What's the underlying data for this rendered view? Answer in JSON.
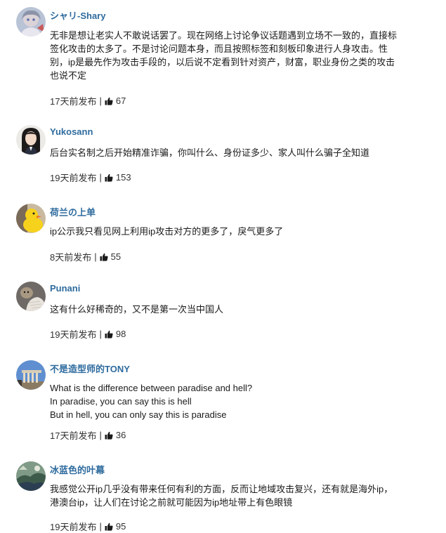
{
  "colors": {
    "username": "#2e6b9e",
    "text": "#1a1a1a",
    "meta": "#333333"
  },
  "comments": [
    {
      "username": "シャリ-Shary",
      "avatar": "avatar-anime-girl-icon",
      "lines": [
        "无非是想让老实人不敢说话罢了。现在网络上讨论争议话题遇到立场不一致的，直接标",
        "签化攻击的太多了。不是讨论问题本身，而且按照标签和刻板印象进行人身攻击。性",
        "别，ip是最先作为攻击手段的，以后说不定看到针对资产，财富，职业身份之类的攻击",
        "也说不定"
      ],
      "time": "17天前发布",
      "sep": "|",
      "likes": "67"
    },
    {
      "username": "Yukosann",
      "avatar": "avatar-girl-portrait-icon",
      "lines": [
        "后台实名制之后开始精准诈骗，你叫什么、身份证多少、家人叫什么骗子全知道"
      ],
      "time": "19天前发布",
      "sep": "|",
      "likes": "153"
    },
    {
      "username": "荷兰の上单",
      "avatar": "avatar-yellow-duck-icon",
      "lines": [
        "ip公示我只看见网上利用ip攻击对方的更多了，戾气更多了"
      ],
      "time": "8天前发布",
      "sep": "|",
      "likes": "55"
    },
    {
      "username": "Punani",
      "avatar": "avatar-dog-icon",
      "lines": [
        "这有什么好稀奇的，又不是第一次当中国人"
      ],
      "time": "19天前发布",
      "sep": "|",
      "likes": "98"
    },
    {
      "username": "不是造型师的TONY",
      "avatar": "avatar-parthenon-icon",
      "lines": [
        "What is the difference between paradise and hell?",
        "In paradise, you can say this is hell",
        "But in hell, you can only say this is paradise"
      ],
      "time": "17天前发布",
      "sep": "|",
      "likes": "36"
    },
    {
      "username": "冰蓝色的叶幕",
      "avatar": "avatar-landscape-icon",
      "lines": [
        "我感觉公开ip几乎没有带来任何有利的方面，反而让地域攻击复兴，还有就是海外ip，",
        "港澳台ip，让人们在讨论之前就可能因为ip地址带上有色眼镜"
      ],
      "time": "19天前发布",
      "sep": "|",
      "likes": "95"
    }
  ]
}
